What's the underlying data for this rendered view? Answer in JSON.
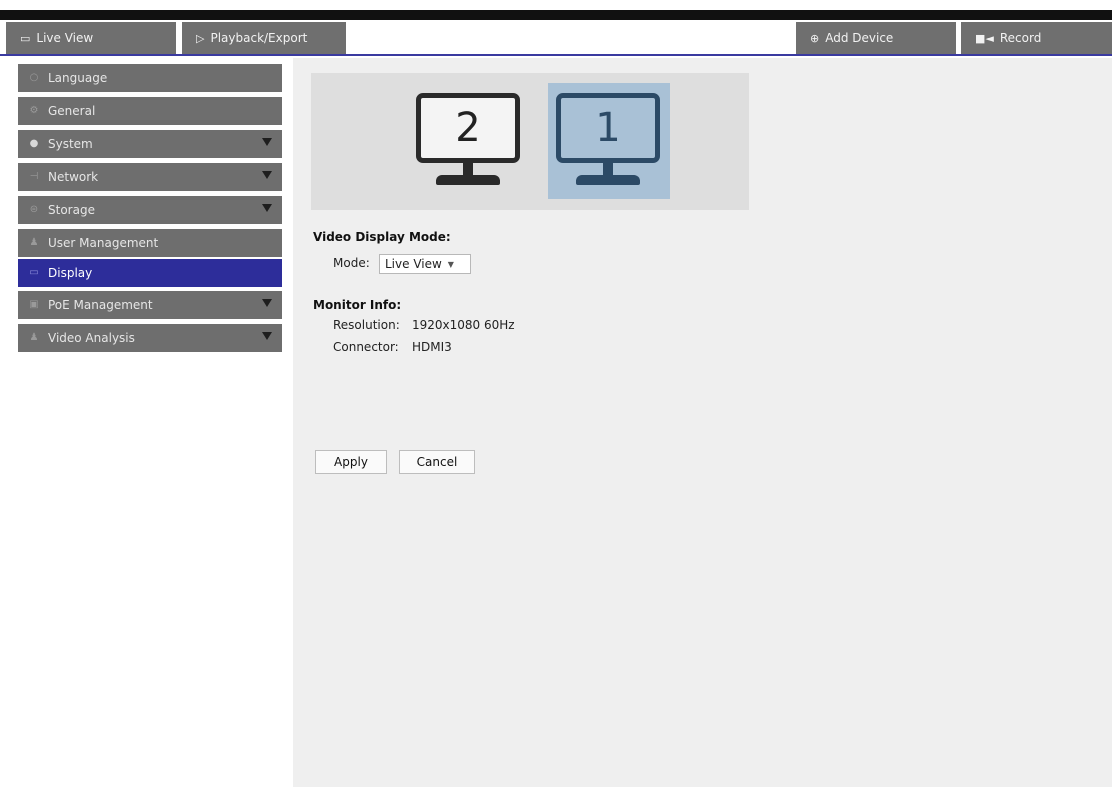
{
  "navbar": {
    "tabs": [
      {
        "label": "Live View",
        "icon": "monitor-icon"
      },
      {
        "label": "Playback/Export",
        "icon": "play-icon"
      },
      {
        "label": "Add Device",
        "icon": "plus-circle-icon"
      },
      {
        "label": "Record",
        "icon": "camera-icon"
      }
    ]
  },
  "sidebar": {
    "items": [
      {
        "label": "Language",
        "icon": "globe-icon",
        "has_submenu": false,
        "active": false
      },
      {
        "label": "General",
        "icon": "gear-icon",
        "has_submenu": false,
        "active": false
      },
      {
        "label": "System",
        "icon": "cog-icon",
        "has_submenu": true,
        "active": false
      },
      {
        "label": "Network",
        "icon": "network-icon",
        "has_submenu": true,
        "active": false
      },
      {
        "label": "Storage",
        "icon": "storage-icon",
        "has_submenu": true,
        "active": false
      },
      {
        "label": "User Management",
        "icon": "users-icon",
        "has_submenu": false,
        "active": false
      },
      {
        "label": "Display",
        "icon": "display-icon",
        "has_submenu": false,
        "active": true
      },
      {
        "label": "PoE Management",
        "icon": "poe-icon",
        "has_submenu": true,
        "active": false
      },
      {
        "label": "Video Analysis",
        "icon": "analysis-icon",
        "has_submenu": true,
        "active": false
      }
    ]
  },
  "main": {
    "monitors": [
      {
        "number": "2",
        "selected": false
      },
      {
        "number": "1",
        "selected": true
      }
    ],
    "video_display_mode_title": "Video Display Mode:",
    "mode_label": "Mode:",
    "mode_value": "Live View",
    "monitor_info_title": "Monitor Info:",
    "resolution_label": "Resolution:",
    "resolution_value": "1920x1080 60Hz",
    "connector_label": "Connector:",
    "connector_value": "HDMI3",
    "apply_label": "Apply",
    "cancel_label": "Cancel"
  },
  "colors": {
    "accent": "#2d2d9a",
    "sidebar_item_bg": "#6e6e6e",
    "monitor_selected": "#a9c1d6"
  }
}
